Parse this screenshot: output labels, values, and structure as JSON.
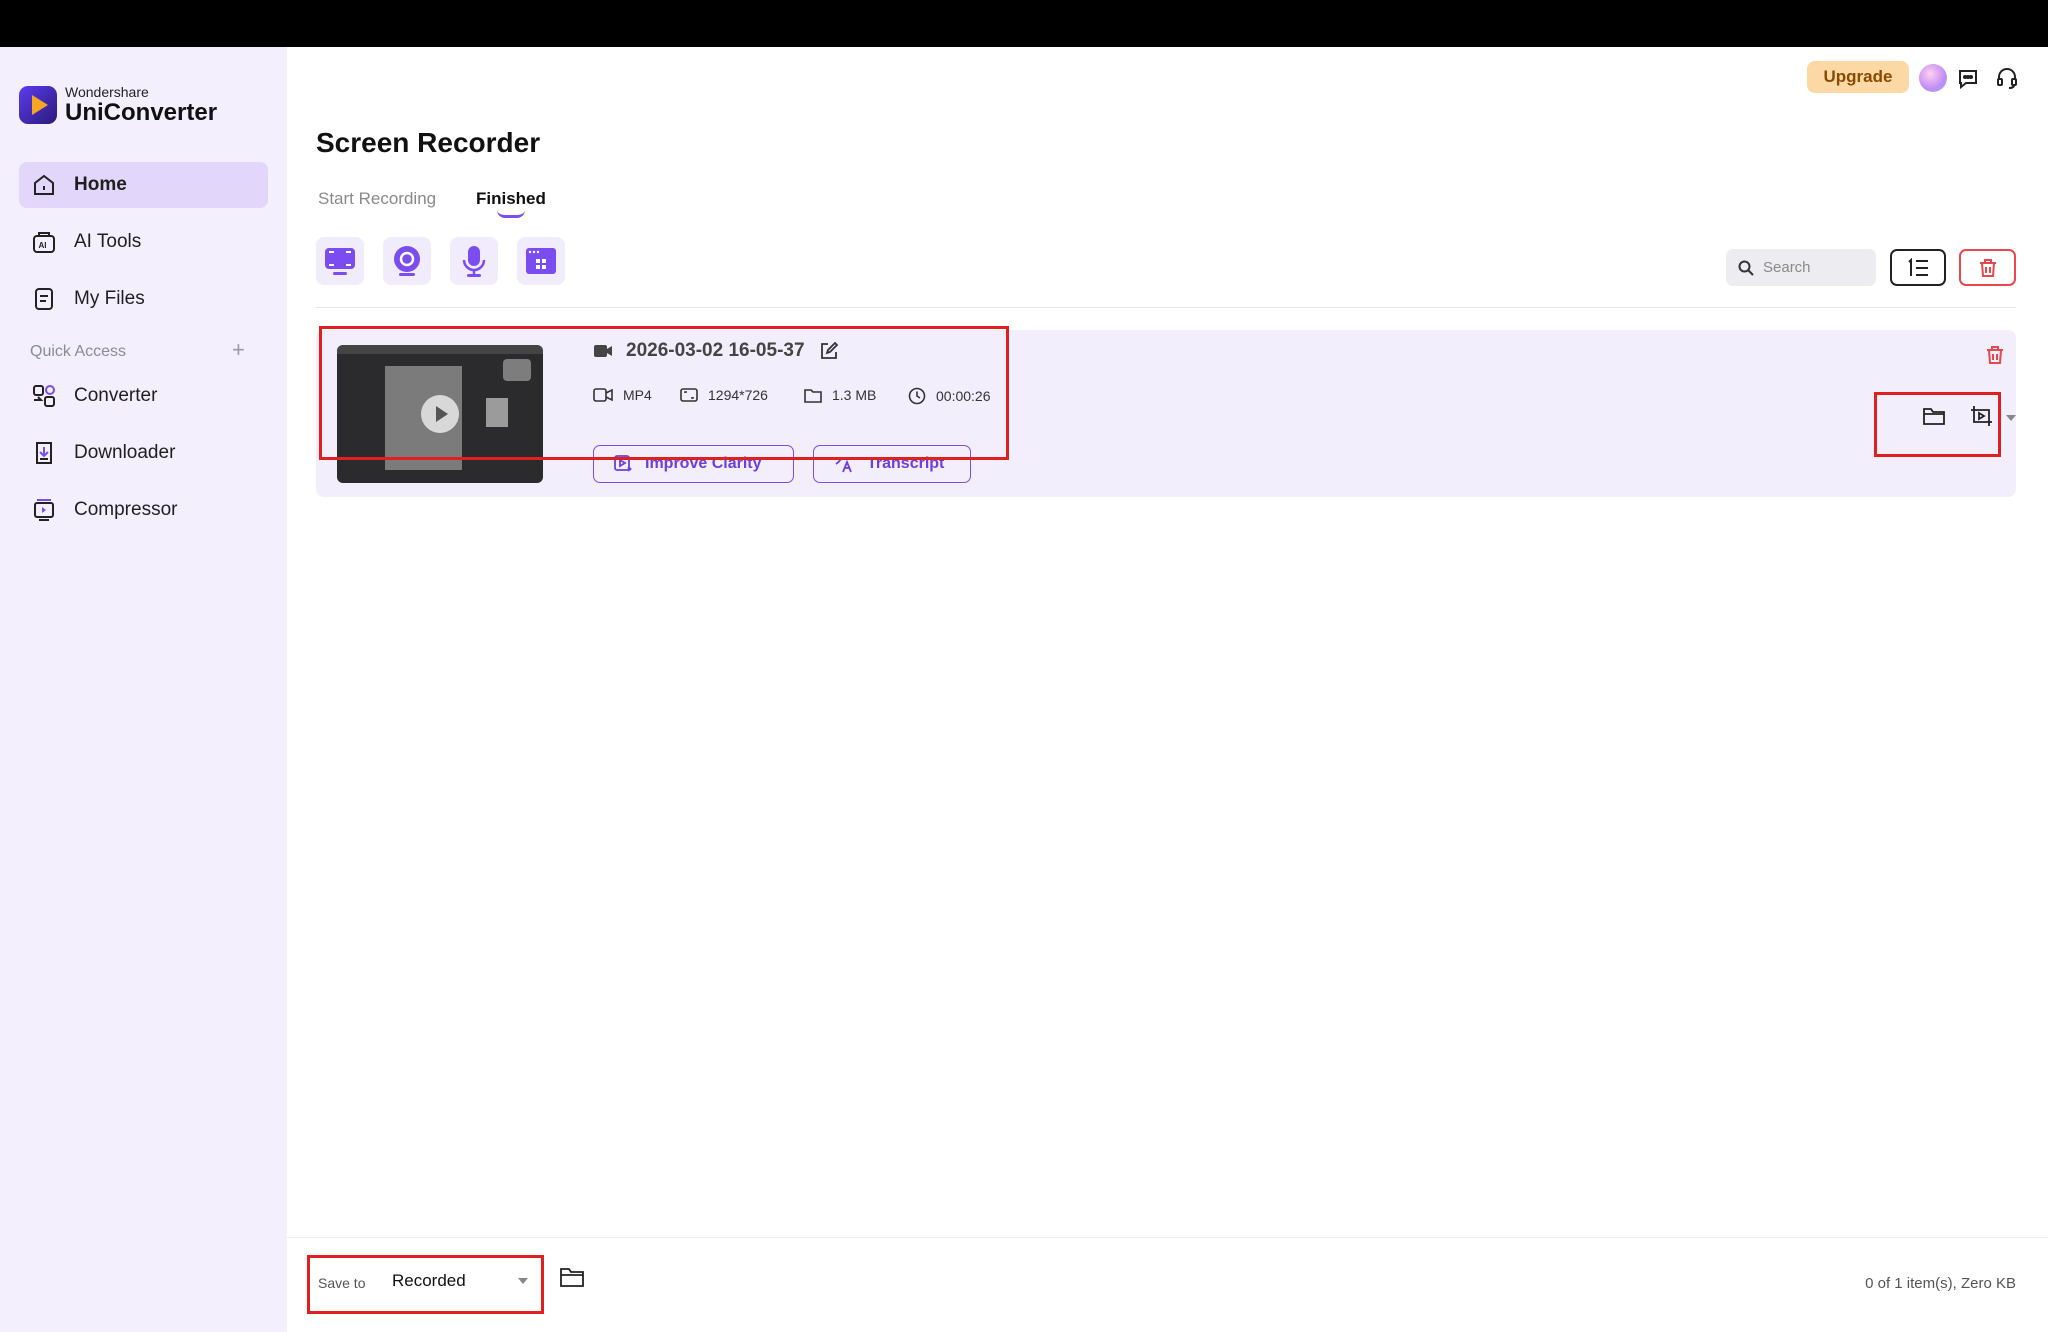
{
  "app": {
    "brand": "Wondershare",
    "product": "UniConverter"
  },
  "sidebar": {
    "items": [
      {
        "label": "Home",
        "icon": "home-icon"
      },
      {
        "label": "AI Tools",
        "icon": "ai-tools-icon"
      },
      {
        "label": "My Files",
        "icon": "files-icon"
      }
    ],
    "quick_access_label": "Quick Access",
    "quick_items": [
      {
        "label": "Converter",
        "icon": "converter-icon"
      },
      {
        "label": "Downloader",
        "icon": "downloader-icon"
      },
      {
        "label": "Compressor",
        "icon": "compressor-icon"
      }
    ]
  },
  "header": {
    "upgrade_label": "Upgrade"
  },
  "page": {
    "title": "Screen Recorder",
    "tabs": [
      "Start Recording",
      "Finished"
    ],
    "search_placeholder": "Search"
  },
  "recording": {
    "name": "2026-03-02 16-05-37",
    "format": "MP4",
    "resolution": "1294*726",
    "size": "1.3 MB",
    "duration": "00:00:26",
    "improve_label": "Improve Clarity",
    "transcript_label": "Transcript"
  },
  "footer": {
    "save_to_label": "Save to",
    "save_location": "Recorded",
    "status": "0 of 1 item(s), Zero KB"
  },
  "colors": {
    "accent": "#7b4cf0",
    "sidebar_bg": "#f3effc",
    "card_bg": "#f2eefb",
    "danger": "#e5484d",
    "highlight": "#e02020"
  }
}
